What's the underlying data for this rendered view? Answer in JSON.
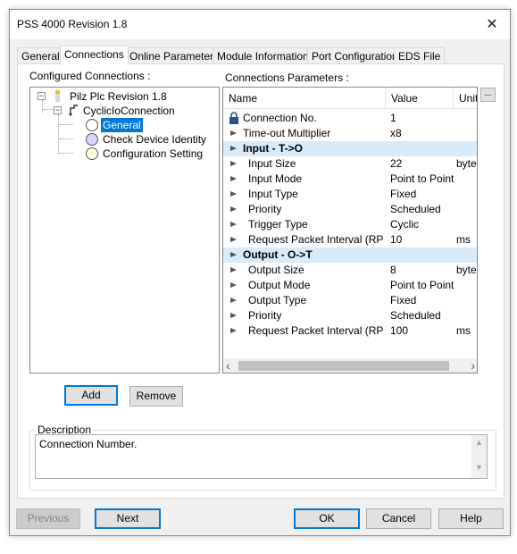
{
  "window": {
    "title": "PSS 4000 Revision 1.8",
    "close_glyph": "✕"
  },
  "tabs": [
    {
      "label": "General",
      "active": false
    },
    {
      "label": "Connections",
      "active": true
    },
    {
      "label": "Online Parameters",
      "active": false
    },
    {
      "label": "Module Informations",
      "active": false
    },
    {
      "label": "Port Configuration",
      "active": false
    },
    {
      "label": "EDS File",
      "active": false
    }
  ],
  "configured": {
    "heading": "Configured Connections :",
    "root": {
      "label": "Pilz Plc Revision 1.8",
      "expander": "−",
      "icon": "device-icon"
    },
    "connection": {
      "label": "CyclicIoConnection",
      "expander": "−",
      "icon": "connection-icon"
    },
    "children": [
      {
        "label": "General",
        "selected": true,
        "color": "#ffffff"
      },
      {
        "label": "Check Device Identity",
        "selected": false,
        "color": "#d8d8ff"
      },
      {
        "label": "Configuration Setting",
        "selected": false,
        "color": "#ffffe0"
      }
    ]
  },
  "parameters": {
    "heading": "Connections Parameters :",
    "columns": {
      "name": "Name",
      "value": "Value",
      "unit": "Unit"
    },
    "more_button": "...",
    "rows": [
      {
        "type": "param",
        "name": "Connection No.",
        "value": "1",
        "unit": "",
        "icon": "lock-icon"
      },
      {
        "type": "param",
        "name": "Time-out Multiplier",
        "value": "x8",
        "unit": "",
        "icon": "arrow-icon"
      },
      {
        "type": "section",
        "name": "Input - T->O"
      },
      {
        "type": "param",
        "name": "Input Size",
        "value": "22",
        "unit": "bytes",
        "icon": "arrow-icon"
      },
      {
        "type": "param",
        "name": "Input Mode",
        "value": "Point to Point",
        "unit": "",
        "icon": "arrow-icon"
      },
      {
        "type": "param",
        "name": "Input Type",
        "value": "Fixed",
        "unit": "",
        "icon": "arrow-icon"
      },
      {
        "type": "param",
        "name": "Priority",
        "value": "Scheduled",
        "unit": "",
        "icon": "arrow-icon"
      },
      {
        "type": "param",
        "name": "Trigger Type",
        "value": "Cyclic",
        "unit": "",
        "icon": "arrow-icon"
      },
      {
        "type": "param",
        "name": "Request Packet Interval (RPI)",
        "value": "10",
        "unit": "ms",
        "icon": "arrow-icon"
      },
      {
        "type": "section",
        "name": "Output - O->T"
      },
      {
        "type": "param",
        "name": "Output Size",
        "value": "8",
        "unit": "bytes",
        "icon": "arrow-icon"
      },
      {
        "type": "param",
        "name": "Output Mode",
        "value": "Point to Point",
        "unit": "",
        "icon": "arrow-icon"
      },
      {
        "type": "param",
        "name": "Output Type",
        "value": "Fixed",
        "unit": "",
        "icon": "arrow-icon"
      },
      {
        "type": "param",
        "name": "Priority",
        "value": "Scheduled",
        "unit": "",
        "icon": "arrow-icon"
      },
      {
        "type": "param",
        "name": "Request Packet Interval (RPI)",
        "value": "100",
        "unit": "ms",
        "icon": "arrow-icon"
      }
    ],
    "scroll_left": "‹",
    "scroll_right": "›"
  },
  "actions": {
    "add": "Add",
    "remove": "Remove"
  },
  "description": {
    "legend": "Description",
    "text": "Connection Number."
  },
  "footer": {
    "previous": "Previous",
    "next": "Next",
    "ok": "OK",
    "cancel": "Cancel",
    "help": "Help"
  },
  "colors": {
    "selection": "#0078d7",
    "section_band": "#d9ebf9",
    "dialog_bg": "#f0f0f0"
  }
}
